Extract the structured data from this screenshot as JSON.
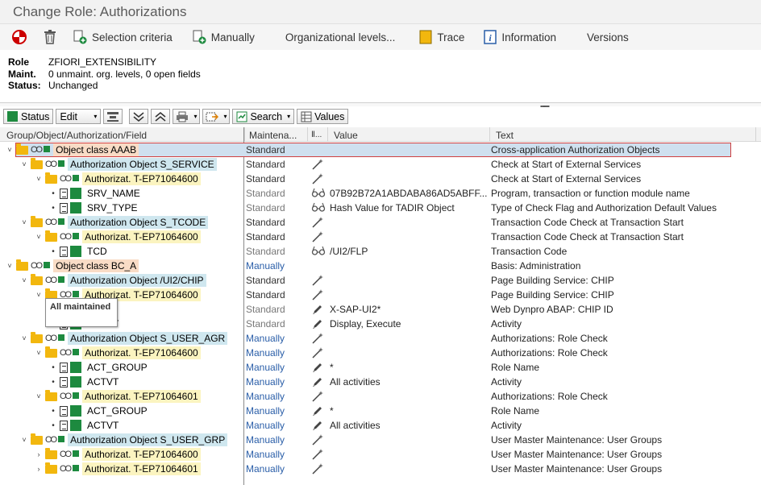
{
  "window": {
    "title": "Change Role: Authorizations"
  },
  "toolbar": {
    "selection": "Selection criteria",
    "manually": "Manually",
    "org_levels": "Organizational levels...",
    "trace": "Trace",
    "information": "Information",
    "versions": "Versions"
  },
  "header": {
    "role_label": "Role",
    "role_value": "ZFIORI_EXTENSIBILITY",
    "maint_label": "Maint.",
    "maint_value": "0 unmaint. org. levels, 0 open fields",
    "status_label": "Status:",
    "status_value": "Unchanged"
  },
  "alv_toolbar": {
    "status": "Status",
    "edit": "Edit",
    "search": "Search",
    "values": "Values"
  },
  "columns": {
    "group": "Group/Object/Authorization/Field",
    "maint": "Maintena...",
    "icon": "Ⅱ...",
    "value": "Value",
    "text": "Text"
  },
  "tooltip": "All maintained",
  "rows": [
    {
      "level": 0,
      "kind": "class",
      "tog": "˅",
      "label": "Object class AAAB",
      "maint": "Standard",
      "mcls": "std",
      "icon": "",
      "value": "",
      "text": "Cross-application Authorization Objects",
      "selected": true
    },
    {
      "level": 1,
      "kind": "obj",
      "tog": "˅",
      "label": "Authorization Object S_SERVICE",
      "maint": "Standard",
      "mcls": "std",
      "icon": "wand",
      "value": "",
      "text": "Check at Start of External Services"
    },
    {
      "level": 2,
      "kind": "auth",
      "tog": "˅",
      "label": "Authorizat. T-EP71064600",
      "maint": "Standard",
      "mcls": "std",
      "icon": "wand",
      "value": "",
      "text": "Check at Start of External Services"
    },
    {
      "level": 3,
      "kind": "field",
      "label": "SRV_NAME",
      "maint": "Standard",
      "mcls": "off",
      "icon": "glasses",
      "value": "07B92B72A1ABDABA86AD5ABFF...",
      "text": "Program, transaction or function module name"
    },
    {
      "level": 3,
      "kind": "field",
      "label": "SRV_TYPE",
      "maint": "Standard",
      "mcls": "off",
      "icon": "glasses",
      "value": "Hash Value for TADIR Object",
      "text": "Type of Check Flag and Authorization Default Values"
    },
    {
      "level": 1,
      "kind": "obj",
      "tog": "˅",
      "label": "Authorization Object S_TCODE",
      "maint": "Standard",
      "mcls": "std",
      "icon": "wand",
      "value": "",
      "text": "Transaction Code Check at Transaction Start"
    },
    {
      "level": 2,
      "kind": "auth",
      "tog": "˅",
      "label": "Authorizat. T-EP71064600",
      "maint": "Standard",
      "mcls": "std",
      "icon": "wand",
      "value": "",
      "text": "Transaction Code Check at Transaction Start"
    },
    {
      "level": 3,
      "kind": "field",
      "label": "TCD",
      "maint": "Standard",
      "mcls": "off",
      "icon": "glasses",
      "value": "/UI2/FLP",
      "text": "Transaction Code"
    },
    {
      "level": 0,
      "kind": "class",
      "tog": "˅",
      "label": "Object class BC_A",
      "maint": "Manually",
      "mcls": "man",
      "icon": "",
      "value": "",
      "text": "Basis: Administration"
    },
    {
      "level": 1,
      "kind": "obj",
      "tog": "˅",
      "label": "Authorization Object /UI2/CHIP",
      "maint": "Standard",
      "mcls": "std",
      "icon": "wand",
      "value": "",
      "text": "Page Building Service: CHIP"
    },
    {
      "level": 2,
      "kind": "auth",
      "tog": "˅",
      "label": "Authorizat. T-EP71064600",
      "maint": "Standard",
      "mcls": "std",
      "icon": "wand",
      "value": "",
      "text": "Page Building Service: CHIP"
    },
    {
      "level": 3,
      "kind": "field",
      "label": "CHIP",
      "maint": "Standard",
      "mcls": "off",
      "icon": "pencil",
      "value": "X-SAP-UI2*",
      "text": "Web Dynpro ABAP: CHIP ID"
    },
    {
      "level": 3,
      "kind": "field",
      "label": "ACTVT",
      "maint": "Standard",
      "mcls": "off",
      "icon": "pencil",
      "value": "Display, Execute",
      "text": "Activity"
    },
    {
      "level": 1,
      "kind": "obj",
      "tog": "˅",
      "label": "Authorization Object S_USER_AGR",
      "maint": "Manually",
      "mcls": "man",
      "icon": "wand",
      "value": "",
      "text": "Authorizations: Role Check"
    },
    {
      "level": 2,
      "kind": "auth",
      "tog": "˅",
      "label": "Authorizat. T-EP71064600",
      "maint": "Manually",
      "mcls": "man",
      "icon": "wand",
      "value": "",
      "text": "Authorizations: Role Check"
    },
    {
      "level": 3,
      "kind": "field",
      "label": "ACT_GROUP",
      "maint": "Manually",
      "mcls": "man",
      "icon": "pencil",
      "value": "*",
      "text": "Role Name"
    },
    {
      "level": 3,
      "kind": "field",
      "label": "ACTVT",
      "maint": "Manually",
      "mcls": "man",
      "icon": "pencil",
      "value": "All activities",
      "text": "Activity"
    },
    {
      "level": 2,
      "kind": "auth",
      "tog": "˅",
      "label": "Authorizat. T-EP71064601",
      "maint": "Manually",
      "mcls": "man",
      "icon": "wand",
      "value": "",
      "text": "Authorizations: Role Check"
    },
    {
      "level": 3,
      "kind": "field",
      "label": "ACT_GROUP",
      "maint": "Manually",
      "mcls": "man",
      "icon": "pencil",
      "value": "*",
      "text": "Role Name"
    },
    {
      "level": 3,
      "kind": "field",
      "label": "ACTVT",
      "maint": "Manually",
      "mcls": "man",
      "icon": "pencil",
      "value": "All activities",
      "text": "Activity"
    },
    {
      "level": 1,
      "kind": "obj",
      "tog": "˅",
      "label": "Authorization Object S_USER_GRP",
      "maint": "Manually",
      "mcls": "man",
      "icon": "wand",
      "value": "",
      "text": "User Master Maintenance: User Groups"
    },
    {
      "level": 2,
      "kind": "auth",
      "tog": "›",
      "label": "Authorizat. T-EP71064600",
      "maint": "Manually",
      "mcls": "man",
      "icon": "wand",
      "value": "",
      "text": "User Master Maintenance: User Groups"
    },
    {
      "level": 2,
      "kind": "auth",
      "tog": "›",
      "label": "Authorizat. T-EP71064601",
      "maint": "Manually",
      "mcls": "man",
      "icon": "wand",
      "value": "",
      "text": "User Master Maintenance: User Groups"
    }
  ]
}
